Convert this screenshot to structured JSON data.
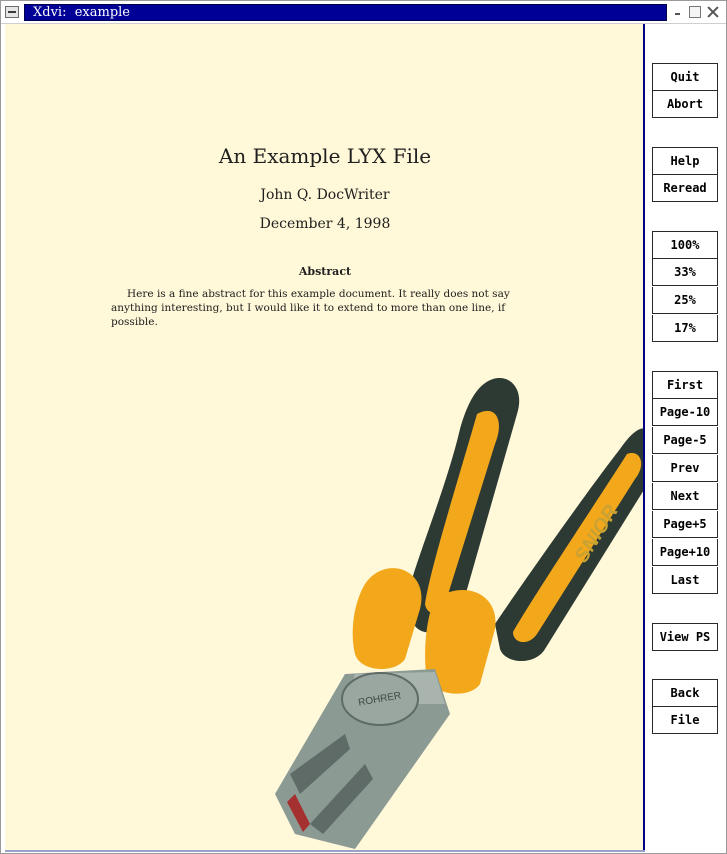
{
  "window": {
    "title": "Xdvi:  example"
  },
  "document": {
    "title": "An Example LYX File",
    "author": "John Q. DocWriter",
    "date": "December 4, 1998",
    "abstract_heading": "Abstract",
    "abstract_text": "Here is a fine abstract for this example document. It really does not say anything interesting, but I would like it to extend to more than one line, if possible.",
    "image_label": "pliers-image"
  },
  "panel": {
    "buttons": [
      {
        "label": "Quit"
      },
      {
        "label": "Abort"
      },
      {
        "label": "Help"
      },
      {
        "label": "Reread"
      },
      {
        "label": "100%"
      },
      {
        "label": "33%"
      },
      {
        "label": "25%"
      },
      {
        "label": "17%"
      },
      {
        "label": "First"
      },
      {
        "label": "Page-10"
      },
      {
        "label": "Page-5"
      },
      {
        "label": "Prev"
      },
      {
        "label": "Next"
      },
      {
        "label": "Page+5"
      },
      {
        "label": "Page+10"
      },
      {
        "label": "Last"
      },
      {
        "label": "View PS"
      },
      {
        "label": "Back"
      },
      {
        "label": "File"
      }
    ]
  },
  "colors": {
    "title_band": "#000096",
    "page_background": "#fff8d9",
    "page_border": "#000080",
    "plier_handle_yellow": "#f3a81c",
    "plier_handle_dark": "#2c3a33",
    "plier_metal": "#8c9a94"
  }
}
